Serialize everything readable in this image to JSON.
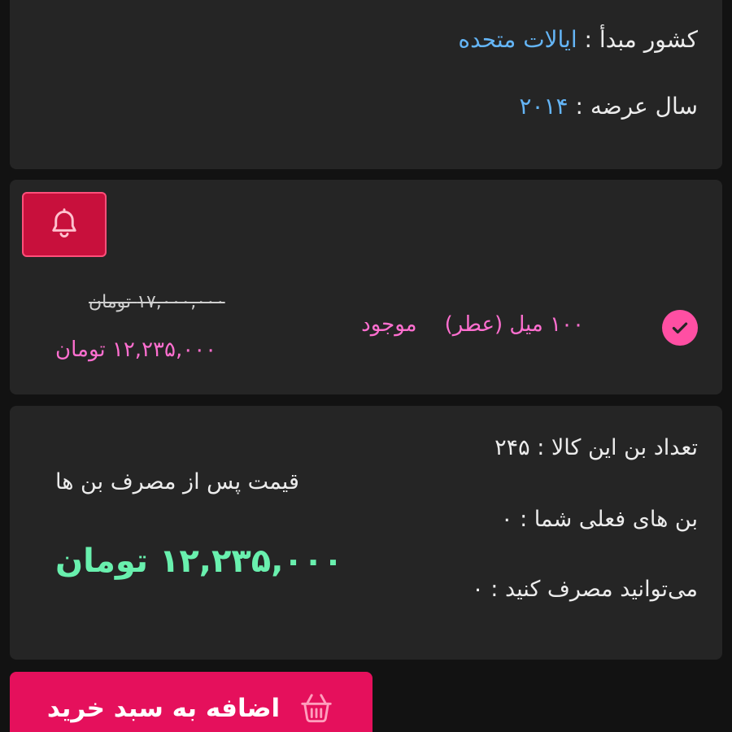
{
  "specs": {
    "origin_label": "کشور مبدأ :",
    "origin_value": "ایالات متحده",
    "year_label": "سال عرضه :",
    "year_value": "۲۰۱۴"
  },
  "variant": {
    "name": "۱۰۰ میل (عطر)",
    "stock": "موجود",
    "old_price": "۱۷,۰۰۰,۰۰۰ تومان",
    "new_price": "۱۲,۲۳۵,۰۰۰ تومان"
  },
  "bon": {
    "count_line": "تعداد بن این کالا : ۲۴۵",
    "current_line": "بن های فعلی شما : ۰",
    "usable_line": "می‌توانید مصرف کنید : ۰",
    "after_label": "قیمت پس از مصرف بن ها",
    "final_price": "۱۲,۲۳۵,۰۰۰ تومان"
  },
  "cart_button": {
    "label": "اضافه به سبد خرید"
  },
  "colors": {
    "accent_pink": "#ff4fa3",
    "price_pink": "#ff6fd0",
    "link_blue": "#64b5f6",
    "final_green": "#69f0ae",
    "cart_red": "#e5105c",
    "bell_red": "#c8103c"
  },
  "icons": {
    "bell": "bell-icon",
    "check": "check-icon",
    "cart": "basket-icon"
  }
}
